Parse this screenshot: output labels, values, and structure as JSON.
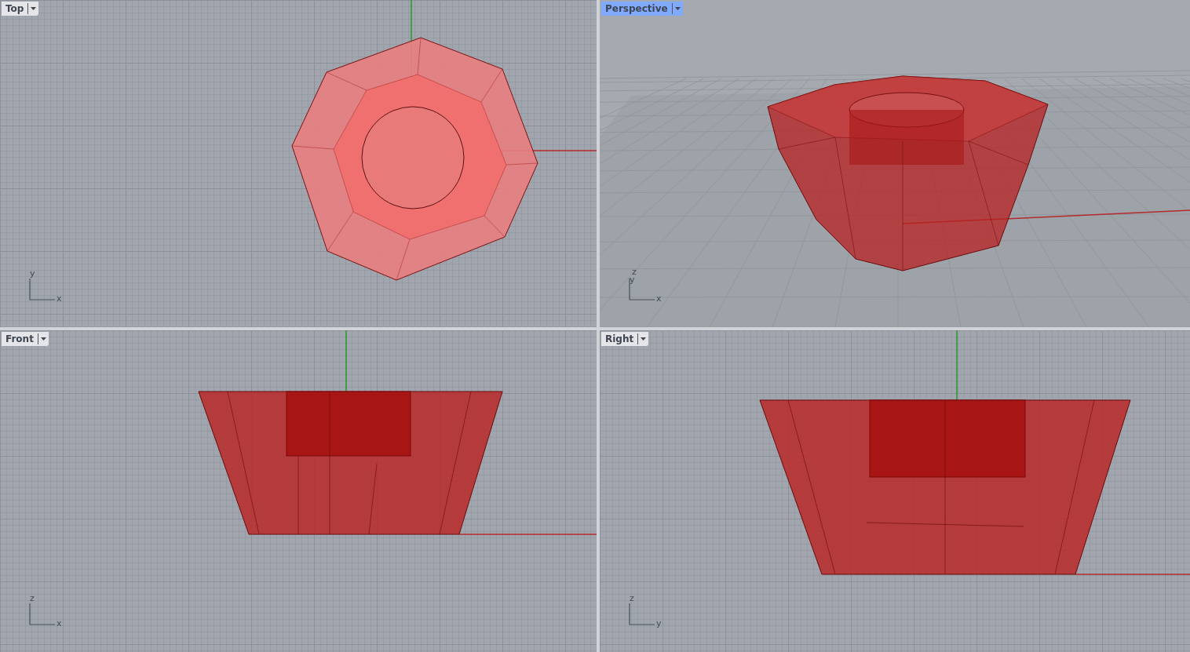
{
  "viewports": [
    {
      "kind": "top",
      "title": "Top",
      "selected": false,
      "axes": [
        "y",
        "x"
      ]
    },
    {
      "kind": "perspective",
      "title": "Perspective",
      "selected": true,
      "axes": [
        "z",
        "y",
        "x"
      ]
    },
    {
      "kind": "front",
      "title": "Front",
      "selected": false,
      "axes": [
        "z",
        "x"
      ]
    },
    {
      "kind": "right",
      "title": "Right",
      "selected": false,
      "axes": [
        "z",
        "y"
      ]
    }
  ]
}
